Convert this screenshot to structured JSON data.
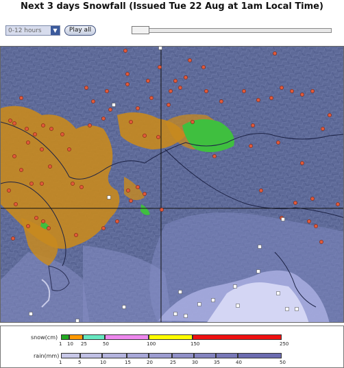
{
  "title": "Next 3 days Snowfall (Issued Tue 22 Aug at 1am Local Time)",
  "controls": {
    "interval_value": "0-12 hours",
    "play_label": "Play all"
  },
  "legend": {
    "snow_label": "snow(cm)",
    "snow_ticks": [
      "1",
      "10",
      "25",
      "50",
      "100",
      "150",
      "250"
    ],
    "snow_colors": [
      "#22aa22",
      "#ff9900",
      "#66e8c0",
      "#ee88ee",
      "#ffff00",
      "#ee1111"
    ],
    "rain_label": "rain(mm)",
    "rain_ticks": [
      "1",
      "5",
      "10",
      "15",
      "20",
      "25",
      "30",
      "35",
      "40",
      "50"
    ],
    "rain_colors": [
      "#c8c8e8",
      "#c0c0e4",
      "#b4b4de",
      "#a8a8d8",
      "#9c9cd0",
      "#9090c8",
      "#8484c0",
      "#7878b8",
      "#6c6cb0"
    ]
  },
  "map": {
    "colors": {
      "terrain": "#5e6a98",
      "snow_low": "#c8891e",
      "snow_mid": "#3fbf3f",
      "rain_light": "#a9aee0",
      "sea": "#d4d6f4",
      "city_marker": "#e05a3a",
      "station_marker": "#ffffff"
    }
  }
}
